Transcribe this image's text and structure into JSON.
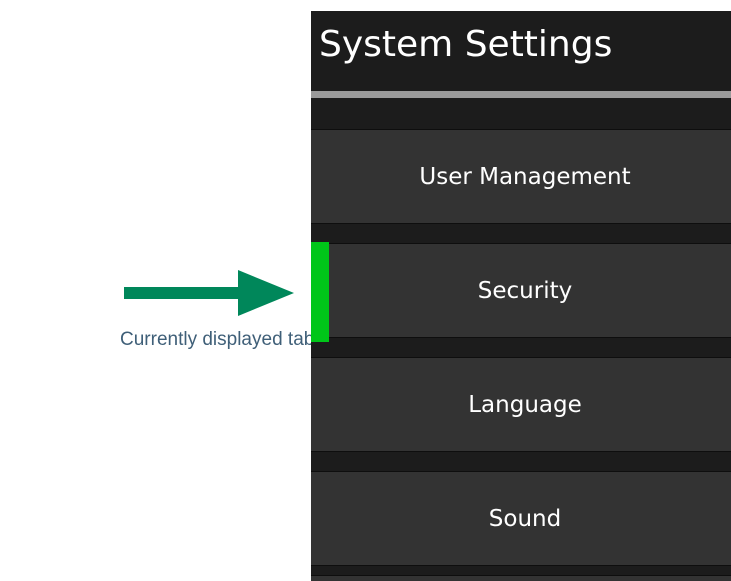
{
  "annotation": {
    "text": "Currently displayed tab",
    "arrow_color": "#00875a"
  },
  "panel": {
    "title": "System Settings",
    "active_tab_index": 1,
    "indicator_color": "#00c619",
    "tabs": [
      {
        "label": "User Management"
      },
      {
        "label": "Security"
      },
      {
        "label": "Language"
      },
      {
        "label": "Sound"
      }
    ]
  }
}
